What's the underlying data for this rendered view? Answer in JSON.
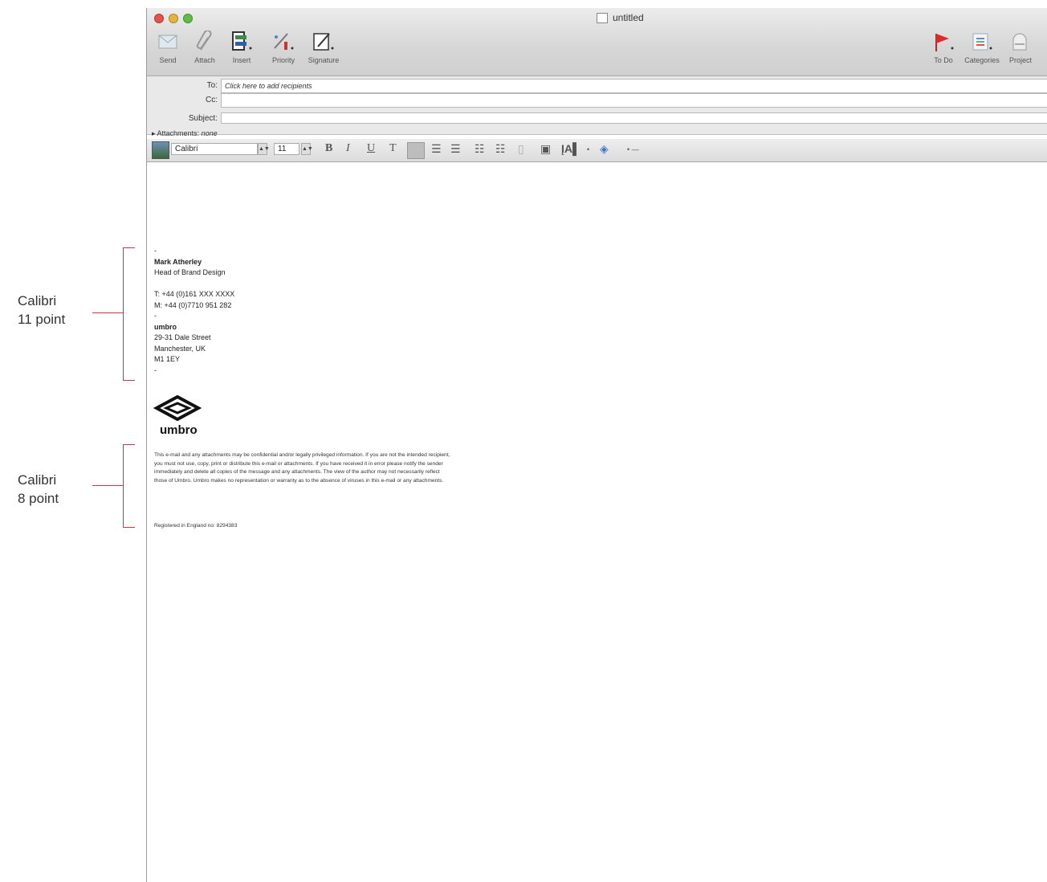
{
  "annotations": [
    {
      "line1": "Calibri",
      "line2": "11 point"
    },
    {
      "line1": "Calibri",
      "line2": "8 point"
    }
  ],
  "window": {
    "title": "untitled",
    "toolbar_left": [
      "Send",
      "Attach",
      "Insert",
      "Priority",
      "Signature"
    ],
    "toolbar_right": [
      "To Do",
      "Categories",
      "Project"
    ]
  },
  "headers": {
    "to_label": "To:",
    "to_placeholder": "Click here to add recipients",
    "cc_label": "Cc:",
    "subject_label": "Subject:",
    "attachments_label": "Attachments:",
    "attachments_value": "none"
  },
  "format_bar": {
    "font": "Calibri",
    "size": "11",
    "bold": "B",
    "italic": "I",
    "underline": "U",
    "strike": "T"
  },
  "signature": {
    "dash1": "-",
    "name": "Mark Atherley",
    "role": "Head of Brand Design",
    "phone": "T: +44  (0)161 XXX XXXX",
    "mobile": "M: +44 (0)7710 951 282",
    "dash2": "-",
    "company": "umbro",
    "address1": "29-31 Dale Street",
    "address2": "Manchester, UK",
    "postcode": "M1 1EY",
    "dash3": "-",
    "logo_word": "umbro",
    "disclaimer": "This e-mail and any attachments may be confidential and/or legally privileged information. If you are not the intended recipient, you must not use, copy, print or distribute this e-mail or attachments. If you have received it in error please notify the sender immediately and delete all copies of the message and any attachments. The view of the author may not necessarily reflect those of Umbro. Umbro makes no representation or warranty as to the absence of viruses in this e-mail or any attachments.",
    "registered": "Registered in England no: 8294383"
  },
  "colors": {
    "bracket": "#c9343e"
  }
}
